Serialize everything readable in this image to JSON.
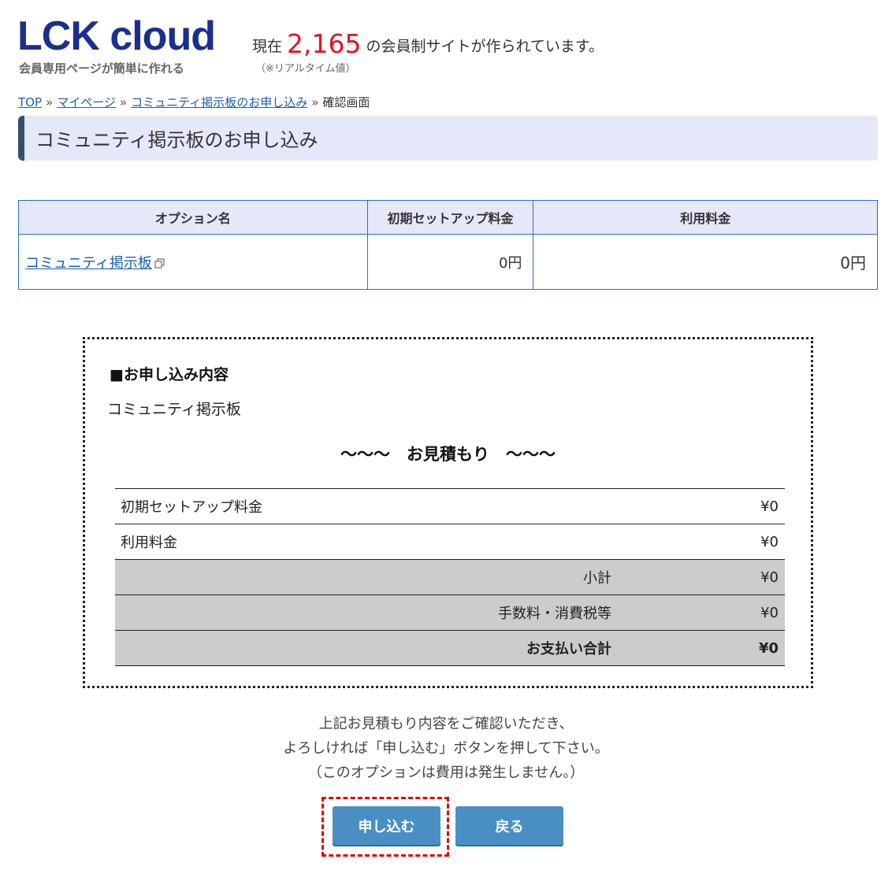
{
  "header": {
    "logo_title": "LCK cloud",
    "logo_sub": "会員専用ページが簡単に作れる",
    "counter_prefix": "現在",
    "counter_value": "2,165",
    "counter_suffix": "の会員制サイトが作られています。",
    "counter_note": "（※リアルタイム値）"
  },
  "breadcrumb": {
    "items": [
      "TOP",
      "マイページ",
      "コミュニティ掲示板のお申し込み"
    ],
    "current": "確認画面",
    "separator": "»"
  },
  "page_title": "コミュニティ掲示板のお申し込み",
  "option_table": {
    "headers": [
      "オプション名",
      "初期セットアップ料金",
      "利用料金"
    ],
    "rows": [
      {
        "name": "コミュニティ掲示板",
        "setup_fee": "0円",
        "usage_fee": "0円"
      }
    ]
  },
  "application": {
    "heading": "■お申し込み内容",
    "item": "コミュニティ掲示板",
    "estimate_title": "～～～　お見積もり　～～～",
    "rows": [
      {
        "label": "初期セットアップ料金",
        "value": "¥0"
      },
      {
        "label": "利用料金",
        "value": "¥0"
      },
      {
        "label": "小計",
        "value": "¥0"
      },
      {
        "label": "手数料・消費税等",
        "value": "¥0"
      },
      {
        "label": "お支払い合計",
        "value": "¥0"
      }
    ]
  },
  "notice": {
    "line1": "上記お見積もり内容をご確認いただき、",
    "line2": "よろしければ「申し込む」ボタンを押して下さい。",
    "line3": "（このオプションは費用は発生しません。）"
  },
  "buttons": {
    "apply": "申し込む",
    "back": "戻る"
  },
  "colors": {
    "logo": "#1b2f8f",
    "counter": "#e3141f",
    "link": "#1a5fb4",
    "button": "#4a8fc4",
    "highlight": "#e00000"
  }
}
